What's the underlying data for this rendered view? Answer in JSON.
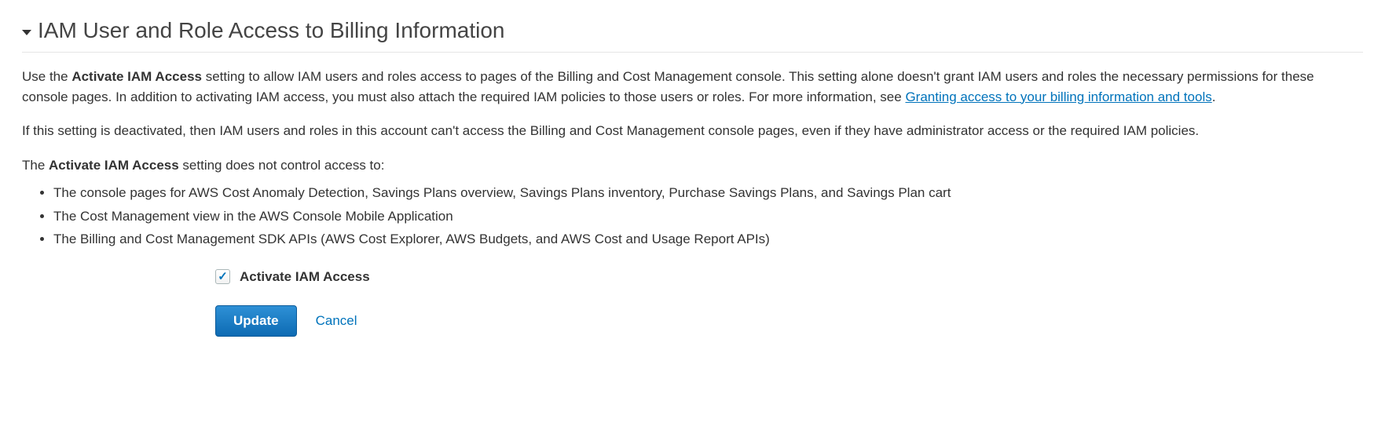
{
  "section": {
    "title": "IAM User and Role Access to Billing Information"
  },
  "paragraph1": {
    "pre": "Use the ",
    "bold": "Activate IAM Access",
    "mid": " setting to allow IAM users and roles access to pages of the Billing and Cost Management console. This setting alone doesn't grant IAM users and roles the necessary permissions for these console pages. In addition to activating IAM access, you must also attach the required IAM policies to those users or roles. For more information, see ",
    "link_text": "Granting access to your billing information and tools",
    "post": "."
  },
  "paragraph2": {
    "text": "If this setting is deactivated, then IAM users and roles in this account can't access the Billing and Cost Management console pages, even if they have administrator access or the required IAM policies."
  },
  "paragraph3": {
    "pre": "The ",
    "bold": "Activate IAM Access",
    "post": " setting does not control access to:"
  },
  "bullets": [
    "The console pages for AWS Cost Anomaly Detection, Savings Plans overview, Savings Plans inventory, Purchase Savings Plans, and Savings Plan cart",
    "The Cost Management view in the AWS Console Mobile Application",
    "The Billing and Cost Management SDK APIs (AWS Cost Explorer, AWS Budgets, and AWS Cost and Usage Report APIs)"
  ],
  "form": {
    "checkbox_label": "Activate IAM Access",
    "checkbox_checked": true,
    "update_label": "Update",
    "cancel_label": "Cancel"
  }
}
